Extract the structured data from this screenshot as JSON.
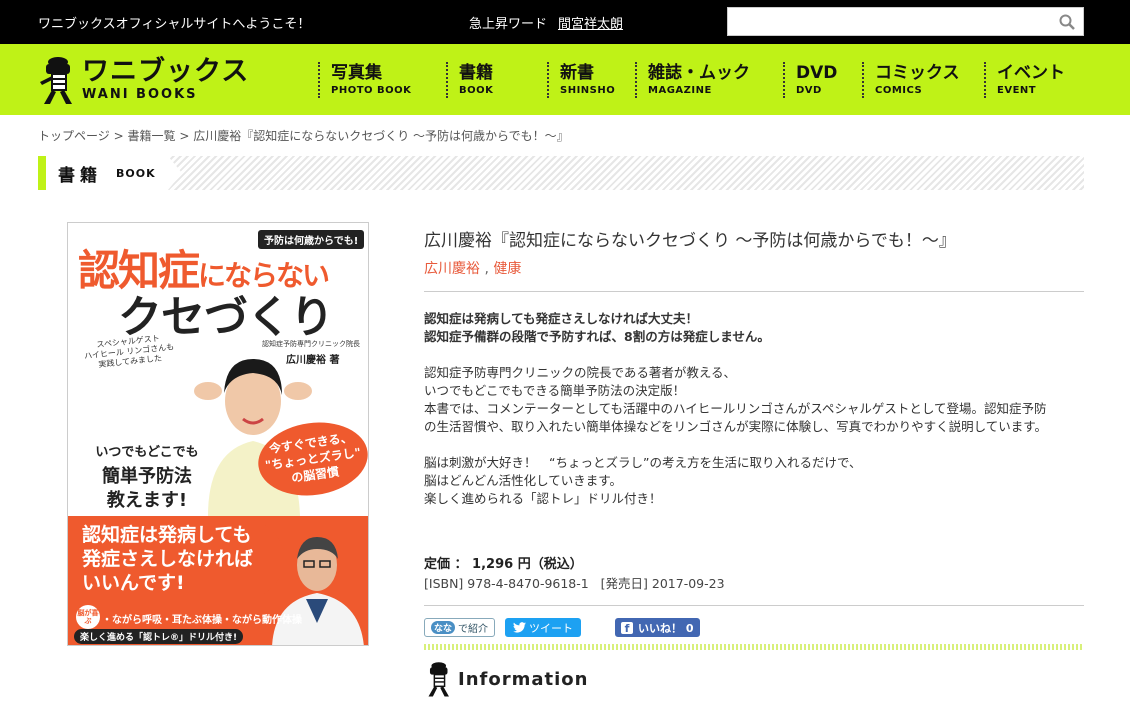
{
  "topbar": {
    "welcome": "ワニブックスオフィシャルサイトへようこそ！",
    "trend_label": "急上昇ワード",
    "trend_link": "間宮祥太朗",
    "search_placeholder": ""
  },
  "header": {
    "logo_jp": "ワニブックス",
    "logo_en": "WANI BOOKS",
    "nav": [
      {
        "jp": "写真集",
        "en": "PHOTO BOOK"
      },
      {
        "jp": "書籍",
        "en": "BOOK"
      },
      {
        "jp": "新書",
        "en": "SHINSHO"
      },
      {
        "jp": "雑誌・ムック",
        "en": "MAGAZINE"
      },
      {
        "jp": "DVD",
        "en": "DVD"
      },
      {
        "jp": "コミックス",
        "en": "COMICS"
      },
      {
        "jp": "イベント",
        "en": "EVENT"
      }
    ]
  },
  "breadcrumb": {
    "home": "トップページ",
    "list": "書籍一覧",
    "current": "広川慶裕『認知症にならないクセづくり ～予防は何歳からでも！～』",
    "sep": ">"
  },
  "section": {
    "jp": "書籍",
    "en": "BOOK"
  },
  "cover": {
    "badge": "予防は何歳からでも!",
    "title1a": "認知症",
    "title1b": "にならない",
    "title2": "クセづくり",
    "guest1": "スペシャルゲスト",
    "guest2": "ハイヒール リンゴさんも",
    "guest3": "実践してみました",
    "author_role": "認知症予防専門クリニック院長",
    "author": "広川慶裕 著",
    "left1": "いつでもどこでも",
    "left2": "簡単予防法",
    "left3": "教えます!",
    "bubble1": "今すぐできる、",
    "bubble2": "\"ちょっとズラし\"",
    "bubble3": "の脳習慣",
    "lower1": "認知症は発病しても",
    "lower2": "発症さえしなければ",
    "lower3": "いいんです!",
    "list_badge": "脳が喜ぶ",
    "list": "・ながら呼吸・耳たぶ体操・ながら動作体操",
    "drill": "楽しく進める「認トレ®」ドリル付き!"
  },
  "book": {
    "title": "広川慶裕『認知症にならないクセづくり ～予防は何歳からでも！～』",
    "tag1": "広川慶裕",
    "tag_sep": ",",
    "tag2": "健康",
    "lead1": "認知症は発病しても発症さえしなければ大丈夫！",
    "lead2": "認知症予備群の段階で予防すれば、8割の方は発症しません。",
    "p1a": "認知症予防専門クリニックの院長である著者が教える、",
    "p1b": "いつでもどこでもできる簡単予防法の決定版！",
    "p1c": "本書では、コメンテーターとしても活躍中のハイヒールリンゴさんがスペシャルゲストとして登場。認知症予防",
    "p1d": "の生活習慣や、取り入れたい簡単体操などをリンゴさんが実際に体験し、写真でわかりやすく説明しています。",
    "p2a": "脳は刺激が大好き！　“ちょっとズラし”の考え方を生活に取り入れるだけで、",
    "p2b": "脳はどんどん活性化していきます。",
    "p2c": "楽しく進められる「認トレ」ドリル付き！",
    "price": "定価 ： 1,296 円（税込）",
    "isbn_label": "[ISBN]",
    "isbn": "978-4-8470-9618-1",
    "date_label": "[発売日]",
    "date": "2017-09-23"
  },
  "social": {
    "intro_icon": "なな",
    "intro": "で紹介",
    "tweet": "ツイート",
    "like": "いいね！ 0"
  },
  "info": {
    "heading": "Information"
  },
  "colors": {
    "brand_green": "#bff217",
    "accent_orange": "#ef5a2e",
    "tag_link": "#e85a3b"
  }
}
